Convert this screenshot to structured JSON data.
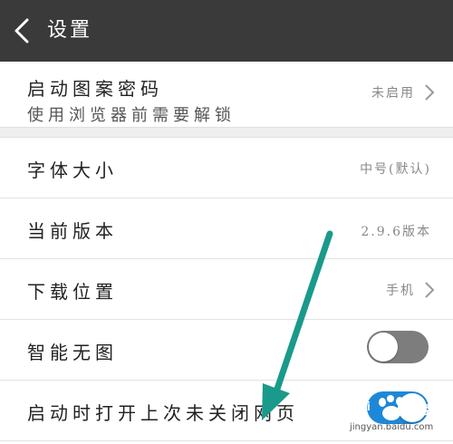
{
  "header": {
    "title": "设置"
  },
  "rows": [
    {
      "label": "启动图案密码",
      "sublabel": "使用浏览器前需要解锁",
      "value": "未启用",
      "chevron": true
    },
    {
      "label": "字体大小",
      "value": "中号(默认)",
      "chevron": false
    },
    {
      "label": "当前版本",
      "value": "2.9.6版本",
      "chevron": false
    },
    {
      "label": "下载位置",
      "value": "手机",
      "chevron": true
    },
    {
      "label": "智能无图",
      "toggle": false
    },
    {
      "label": "启动时打开上次未关闭网页",
      "toggle": true
    }
  ],
  "watermark": {
    "brand_left": "Bai",
    "brand_mid": "du",
    "brand_right": "经验",
    "url": "jingyan.baidu.com"
  },
  "colors": {
    "topbar": "#3a3a3a",
    "arrow": "#1a9a8a",
    "toggle_off": "#7d7d7d",
    "toggle_on": "#1e88d8"
  }
}
